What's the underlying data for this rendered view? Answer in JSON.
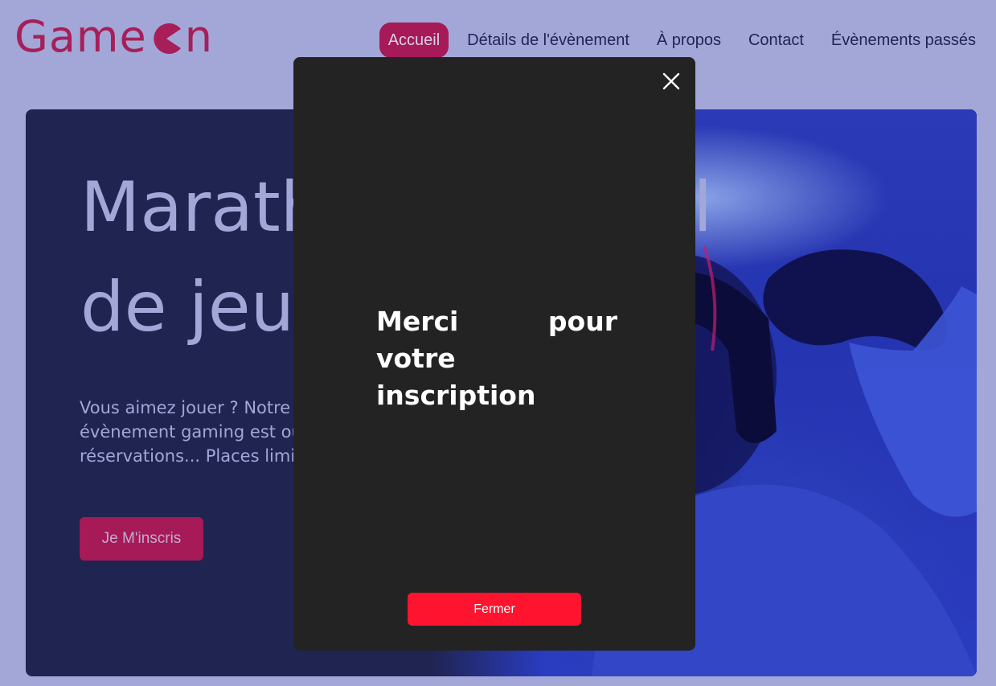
{
  "brand": {
    "logo_text_left": "Game",
    "logo_text_right": "n",
    "logo_icon": "pacman-icon",
    "color": "#a61f59"
  },
  "nav": {
    "items": [
      {
        "label": "Accueil",
        "active": true
      },
      {
        "label": "Détails de l'évènement"
      },
      {
        "label": "À propos"
      },
      {
        "label": "Contact"
      },
      {
        "label": "Évènements passés"
      }
    ],
    "active_color": "#a51a57"
  },
  "hero": {
    "title_line1": "Marathon national",
    "title_line2": "de jeux vidéos",
    "text_line1": "Vous aimez jouer ? Notre prochain",
    "text_line2": "évènement gaming est ouvert aux",
    "text_line3": "réservations... Places limitées !",
    "cta_label": "Je M'inscris"
  },
  "modal": {
    "message": "Merci pour votre inscription",
    "close_icon": "close-icon",
    "close_button_label": "Fermer",
    "button_color": "#fe142f"
  }
}
